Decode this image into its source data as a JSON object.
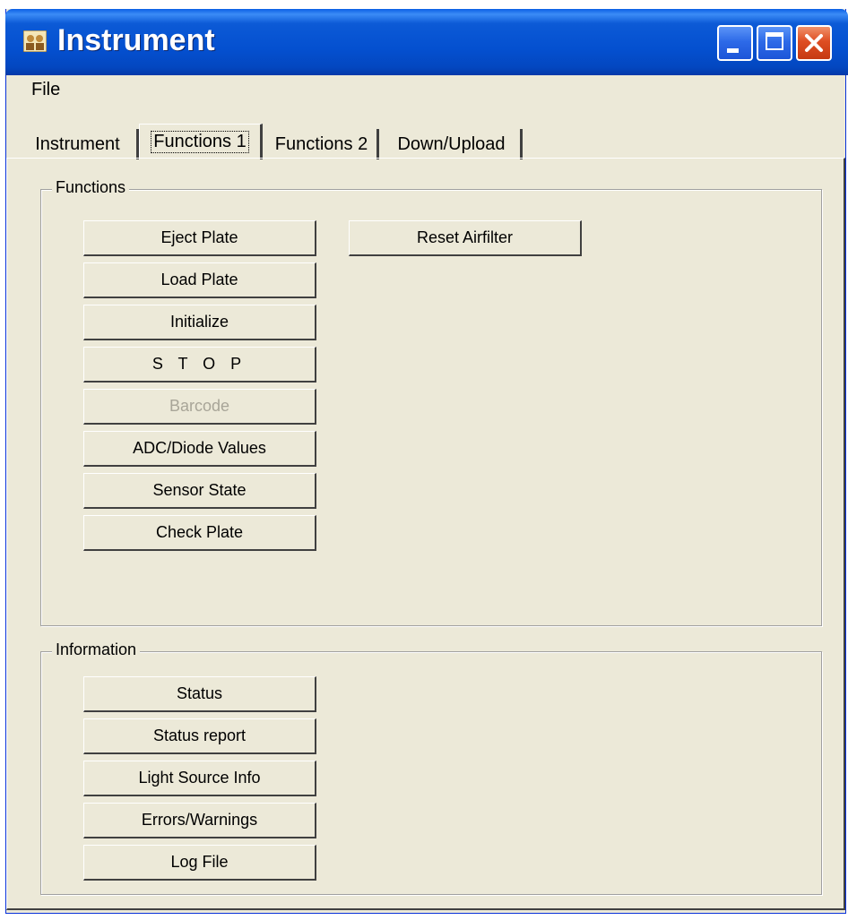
{
  "window": {
    "title": "Instrument",
    "icon": "instrument-app-icon",
    "controls": [
      "minimize-icon",
      "maximize-icon",
      "close-icon"
    ]
  },
  "menu": {
    "items": [
      "File"
    ]
  },
  "tabs": [
    {
      "label": "Instrument",
      "active": false
    },
    {
      "label": "Functions 1",
      "active": true
    },
    {
      "label": "Functions 2",
      "active": false
    },
    {
      "label": "Down/Upload",
      "active": false
    }
  ],
  "functions_group": {
    "label": "Functions",
    "buttons": [
      {
        "label": "Eject Plate",
        "enabled": true
      },
      {
        "label": "Load Plate",
        "enabled": true
      },
      {
        "label": "Initialize",
        "enabled": true
      },
      {
        "label": "S T O P",
        "enabled": true
      },
      {
        "label": "Barcode",
        "enabled": false
      },
      {
        "label": "ADC/Diode Values",
        "enabled": true
      },
      {
        "label": "Sensor State",
        "enabled": true
      },
      {
        "label": "Check Plate",
        "enabled": true
      }
    ],
    "reset_airfilter": {
      "label": "Reset Airfilter",
      "enabled": true
    }
  },
  "information_group": {
    "label": "Information",
    "buttons": [
      {
        "label": "Status",
        "enabled": true
      },
      {
        "label": "Status report",
        "enabled": true
      },
      {
        "label": "Light Source Info",
        "enabled": true
      },
      {
        "label": "Errors/Warnings",
        "enabled": true
      },
      {
        "label": "Log File",
        "enabled": true
      }
    ]
  }
}
